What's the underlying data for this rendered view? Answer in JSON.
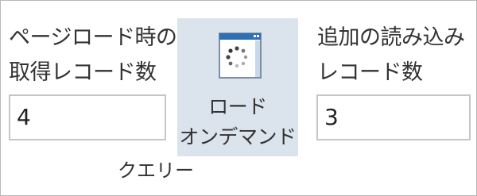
{
  "query_group": {
    "label": "クエリー",
    "initial_load": {
      "label_line1": "ページロード時の",
      "label_line2": "取得レコード数",
      "value": "4"
    },
    "load_on_demand": {
      "label_line1": "ロード",
      "label_line2": "オンデマンド",
      "icon": "loading-spinner-window-icon"
    },
    "additional_load": {
      "label_line1": "追加の読み込み",
      "label_line2": "レコード数",
      "value": "3"
    }
  },
  "colors": {
    "button_bg": "#dbe3ec",
    "field_border": "#c6c6c6",
    "text": "#333333",
    "icon_accent": "#2f6fb3"
  }
}
